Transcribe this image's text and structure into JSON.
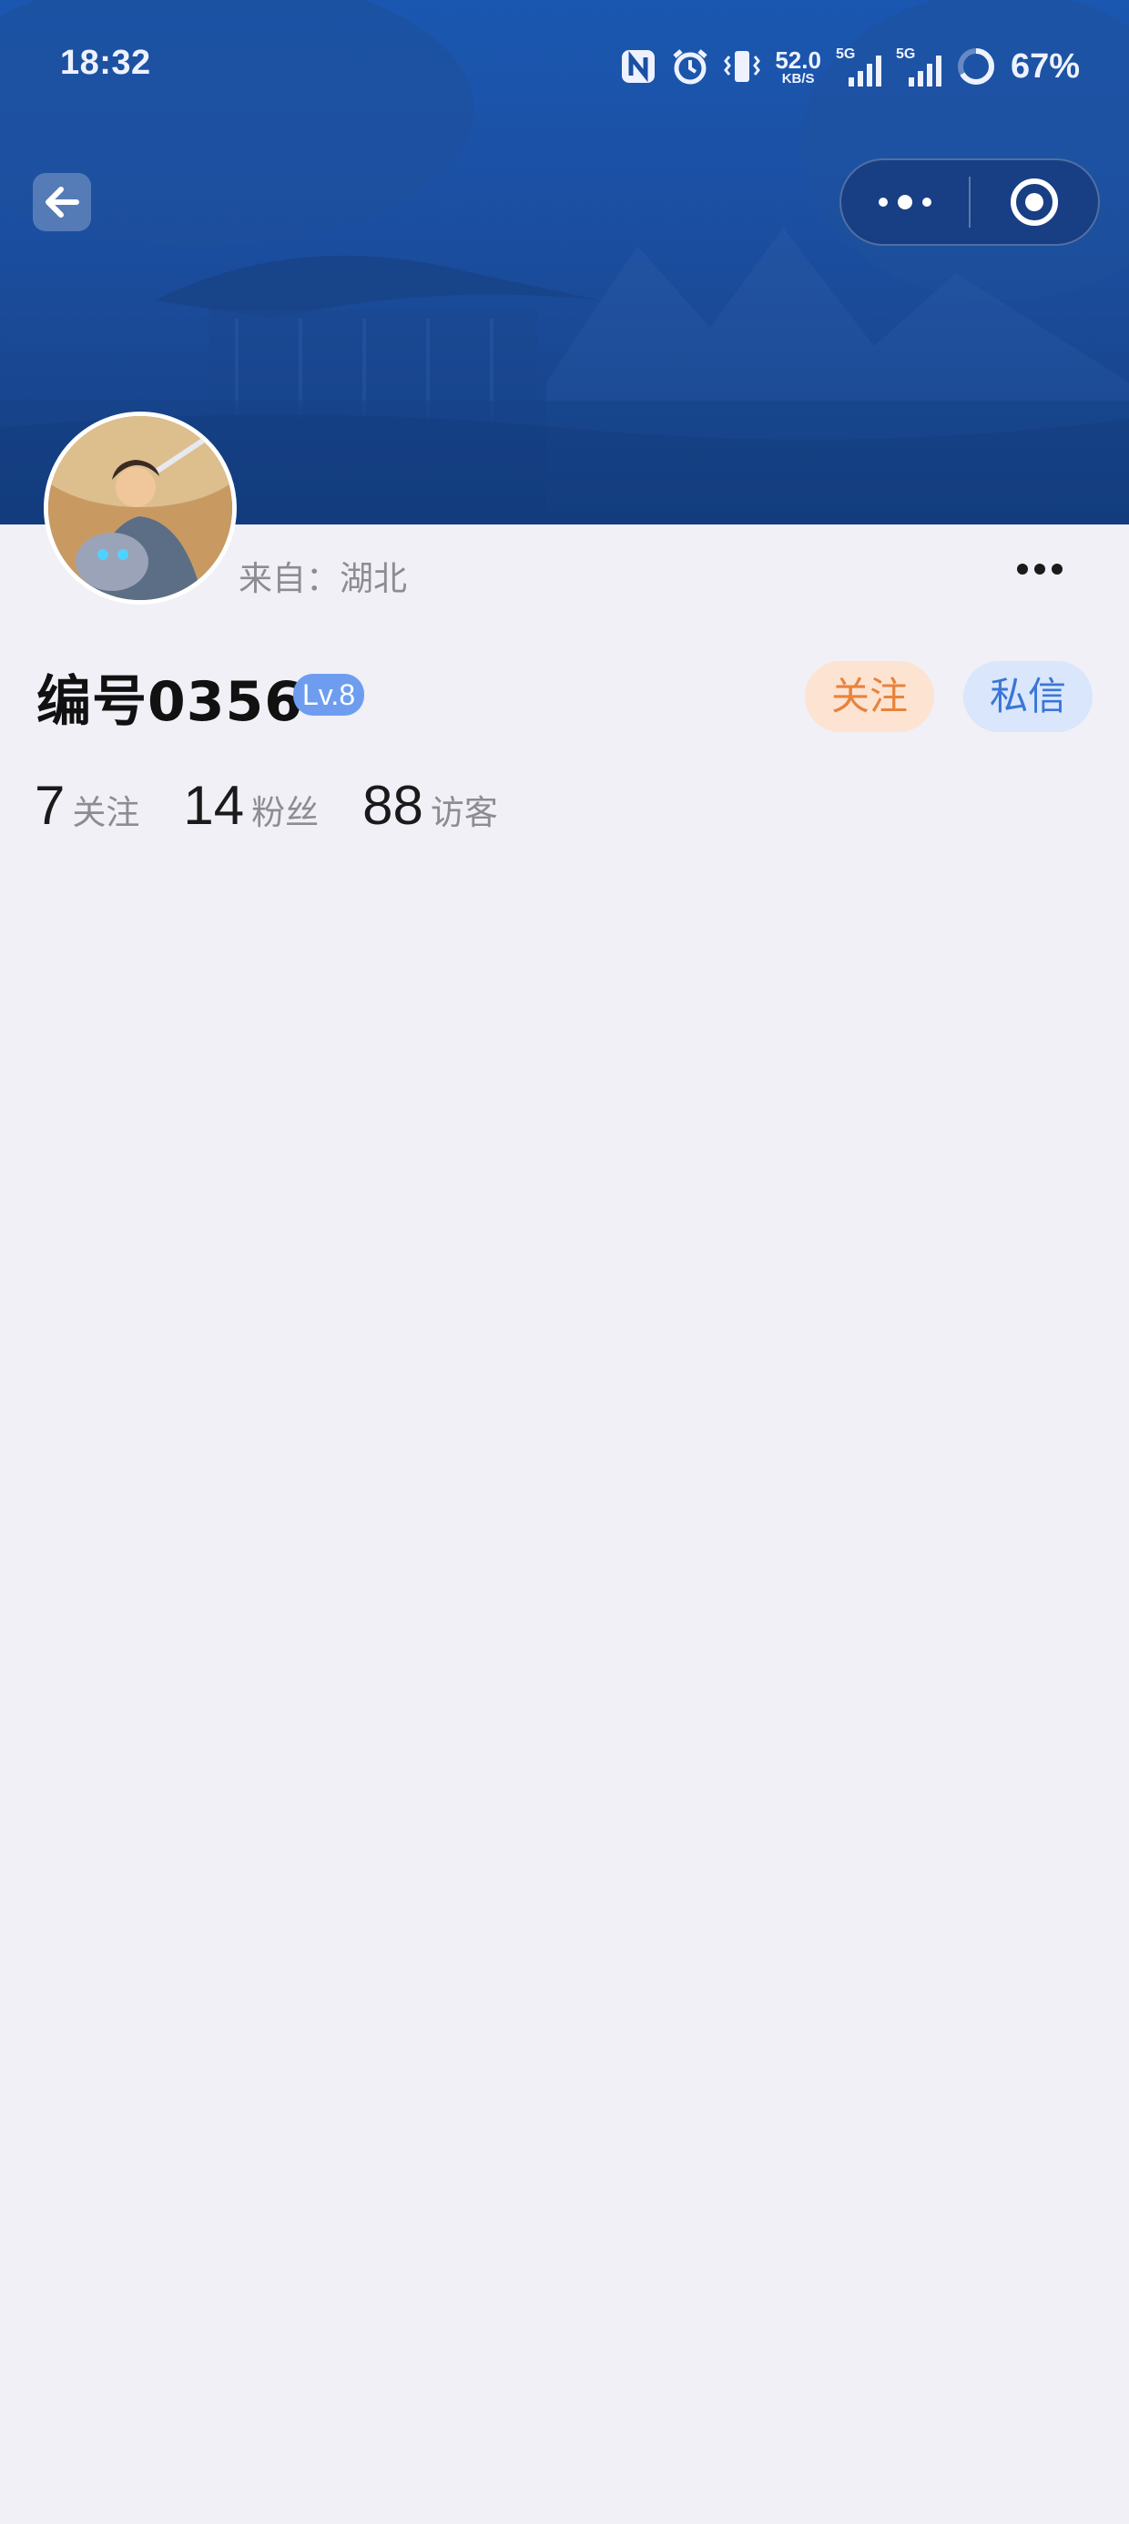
{
  "status_bar": {
    "time": "18:32",
    "net_speed_value": "52.0",
    "net_speed_unit": "KB/S",
    "signal_1_label": "5G",
    "signal_2_label": "5G",
    "battery_percent": "67%",
    "icons": [
      "nfc-icon",
      "alarm-icon",
      "vibrate-icon",
      "signal-5g-icon",
      "signal-5g-icon",
      "battery-ring-icon"
    ]
  },
  "nav": {
    "back_icon": "arrow-left-icon",
    "capsule_icons": [
      "more-dots-icon",
      "close-target-icon"
    ]
  },
  "profile": {
    "origin": "来自：湖北",
    "username": "编号0356",
    "level": "Lv.8",
    "more_icon": "ellipsis-icon",
    "follow_label": "关注",
    "message_label": "私信",
    "stats": [
      {
        "value": "7",
        "label": "关注"
      },
      {
        "value": "14",
        "label": "粉丝"
      },
      {
        "value": "88",
        "label": "访客"
      }
    ]
  },
  "colors": {
    "banner": "#1a4fa3",
    "page_bg": "#f0f0f6",
    "follow_bg": "#fde3d1",
    "follow_text": "#e8833c",
    "message_bg": "#d9e6fb",
    "message_text": "#3a76d6",
    "level_badge": "#6e9df0"
  }
}
